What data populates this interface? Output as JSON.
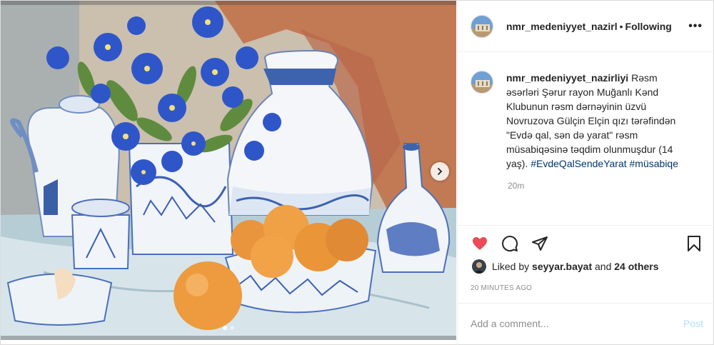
{
  "header": {
    "username": "nmr_medeniyyet_nazirl",
    "separator": "•",
    "follow_state": "Following",
    "more_label": "•••"
  },
  "caption": {
    "username": "nmr_medeniyyet_nazirliyi",
    "text": "Rəsm əsərləri Şərur rayon Muğanlı Kənd Klubunun rəsm dərnəyinin üzvü Novruzova Gülçin Elçin qızı tərəfindən \"Evdə qal, sən də yarat\" rəsm müsabiqəsinə təqdim olunmuşdur (14 yaş).",
    "hashtag_1": "#EvdeQalSendeYarat",
    "hashtag_2": "#müsabiqe",
    "age": "20m"
  },
  "actions": {
    "like_icon": "heart-filled-icon",
    "comment_icon": "comment-icon",
    "share_icon": "share-icon",
    "save_icon": "bookmark-icon",
    "like_color": "#ed4956"
  },
  "likes": {
    "prefix": "Liked by",
    "user": "seyyar.bayat",
    "and": "and",
    "others": "24 others"
  },
  "post_date": "20 MINUTES AGO",
  "add_comment": {
    "placeholder": "Add a comment...",
    "post_label": "Post"
  },
  "carousel": {
    "dot_count": 2,
    "active_index": 0
  }
}
